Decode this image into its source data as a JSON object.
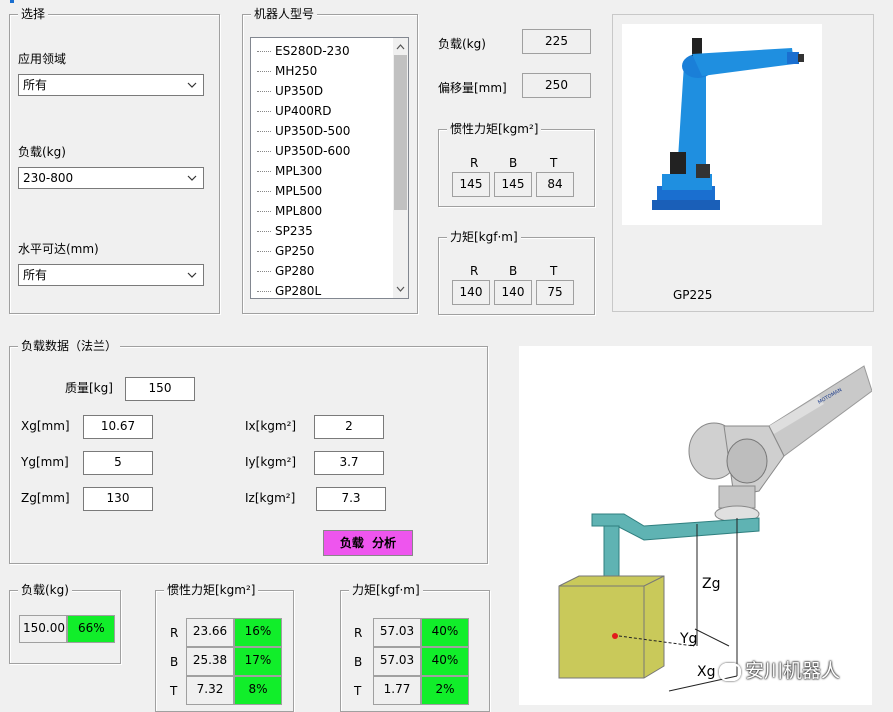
{
  "select_group": {
    "title": "选择",
    "field_label": "应用领域",
    "field_value": "所有",
    "load_label": "负载(kg)",
    "load_value": "230-800",
    "reach_label": "水平可达(mm)",
    "reach_value": "所有"
  },
  "model_group": {
    "title": "机器人型号",
    "items": [
      "ES280D-230",
      "MH250",
      "UP350D",
      "UP400RD",
      "UP350D-500",
      "UP350D-600",
      "MPL300",
      "MPL500",
      "MPL800",
      "SP235",
      "GP250",
      "GP280",
      "GP280L"
    ]
  },
  "spec": {
    "load_label": "负载(kg)",
    "load_value": "225",
    "offset_label": "偏移量[mm]",
    "offset_value": "250",
    "inertia": {
      "title": "惯性力矩[kgm²]",
      "headers": [
        "R",
        "B",
        "T"
      ],
      "values": [
        "145",
        "145",
        "84"
      ]
    },
    "torque": {
      "title": "力矩[kgf·m]",
      "headers": [
        "R",
        "B",
        "T"
      ],
      "values": [
        "140",
        "140",
        "75"
      ]
    }
  },
  "robot_image": {
    "caption": "GP225",
    "arm_color": "#1f8fe0",
    "base_color": "#1a6fd0"
  },
  "payload_group": {
    "title": "负载数据（法兰）",
    "mass_label": "质量[kg]",
    "mass_value": "150",
    "xg_label": "Xg[mm]",
    "xg_value": "10.67",
    "yg_label": "Yg[mm]",
    "yg_value": "5",
    "zg_label": "Zg[mm]",
    "zg_value": "130",
    "ix_label": "Ix[kgm²]",
    "ix_value": "2",
    "iy_label": "Iy[kgm²]",
    "iy_value": "3.7",
    "iz_label": "Iz[kgm²]",
    "iz_value": "7.3",
    "analyze_button": "负载  分析",
    "button_color": "#ee55ee"
  },
  "result_load": {
    "title": "负载(kg)",
    "value": "150.00",
    "percent": 0.66,
    "percent_text": "66%"
  },
  "result_inertia": {
    "title": "惯性力矩[kgm²]",
    "rows": [
      {
        "axis": "R",
        "value": "23.66",
        "percent": 0.16,
        "percent_text": "16%"
      },
      {
        "axis": "B",
        "value": "25.38",
        "percent": 0.17,
        "percent_text": "17%"
      },
      {
        "axis": "T",
        "value": "7.32",
        "percent": 0.08,
        "percent_text": "8%"
      }
    ]
  },
  "result_torque": {
    "title": "力矩[kgf·m]",
    "rows": [
      {
        "axis": "R",
        "value": "57.03",
        "percent": 0.4,
        "percent_text": "40%"
      },
      {
        "axis": "B",
        "value": "57.03",
        "percent": 0.4,
        "percent_text": "40%"
      },
      {
        "axis": "T",
        "value": "1.77",
        "percent": 0.02,
        "percent_text": "2%"
      }
    ]
  },
  "diagram": {
    "zg_label": "Zg",
    "yg_label": "Yg",
    "xg_label": "Xg",
    "brand": "MOTOMAN"
  },
  "watermark": "安川机器人",
  "ok_color": "#11ee2a"
}
